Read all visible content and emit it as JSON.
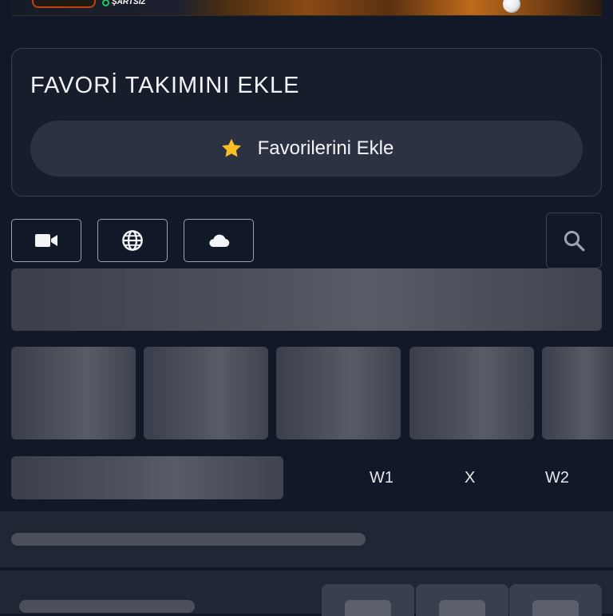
{
  "banner": {
    "tag_text": "ŞARTSIZ"
  },
  "favorites": {
    "title": "FAVORİ TAKIMINI EKLE",
    "button_label": "Favorilerini Ekle",
    "star_color": "#fbbf24"
  },
  "filters": [
    {
      "icon": "video-camera-icon"
    },
    {
      "icon": "globe-icon"
    },
    {
      "icon": "cloud-icon"
    }
  ],
  "search": {
    "icon": "search-icon"
  },
  "odds_headers": {
    "w1": "W1",
    "x": "X",
    "w2": "W2"
  },
  "colors": {
    "background": "#111827",
    "card": "#161d2b",
    "card_border": "#394150",
    "button": "#2b3342",
    "skeleton": "#4e535e"
  }
}
